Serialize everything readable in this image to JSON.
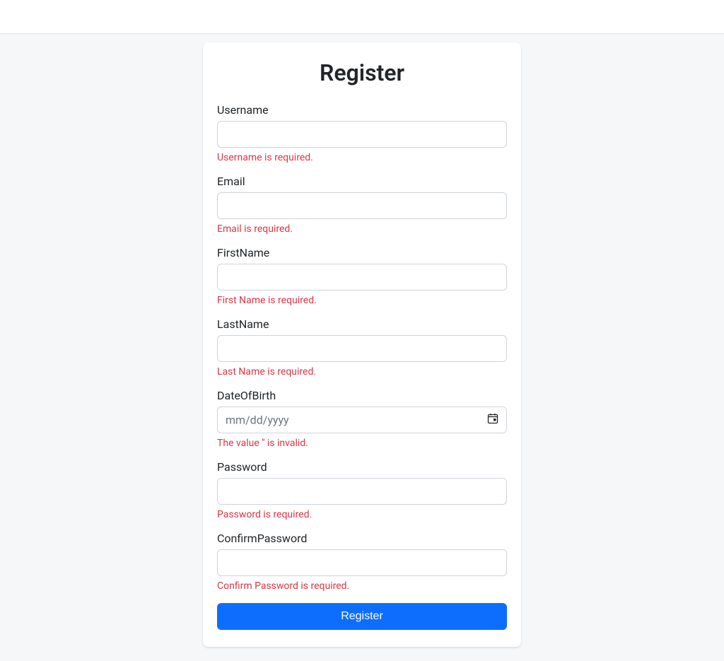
{
  "page": {
    "title": "Register"
  },
  "fields": {
    "username": {
      "label": "Username",
      "value": "",
      "error": "Username is required."
    },
    "email": {
      "label": "Email",
      "value": "",
      "error": "Email is required."
    },
    "firstname": {
      "label": "FirstName",
      "value": "",
      "error": "First Name is required."
    },
    "lastname": {
      "label": "LastName",
      "value": "",
      "error": "Last Name is required."
    },
    "dob": {
      "label": "DateOfBirth",
      "placeholder": "mm/dd/yyyy",
      "value": "",
      "error": "The value '' is invalid."
    },
    "password": {
      "label": "Password",
      "value": "",
      "error": "Password is required."
    },
    "confirmpassword": {
      "label": "ConfirmPassword",
      "value": "",
      "error": "Confirm Password is required."
    }
  },
  "actions": {
    "submit_label": "Register"
  },
  "colors": {
    "primary": "#0d6efd",
    "error": "#dc3545",
    "border": "#ced4da",
    "bg": "#f6f7f9"
  }
}
